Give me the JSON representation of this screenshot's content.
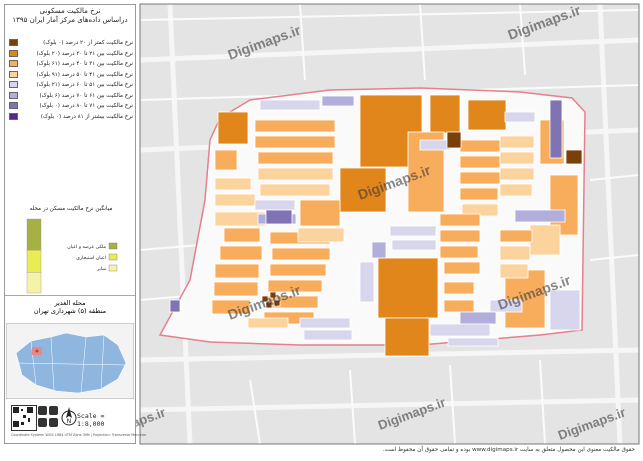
{
  "legend": {
    "title_line1": "نرخ مالکیت مسکونی",
    "title_line2": "دراساس داده‌های مرکز آمار ایران ۱۳۹۵",
    "items": [
      {
        "label": "نرخ مالکیت کمتر از ۲۰ درصد (۰ بلوک)",
        "color": "#7b3f0a"
      },
      {
        "label": "نرخ مالکیت بین ۲۱ تا ۳۰ درصد (۲۰ بلوک)",
        "color": "#e0861a"
      },
      {
        "label": "نرخ مالکیت بین ۳۱ تا ۴۰ درصد (۶۱ بلوک)",
        "color": "#f7ad5c"
      },
      {
        "label": "نرخ مالکیت بین ۴۱ تا ۵۰ درصد (۹۱ بلوک)",
        "color": "#fcd29d"
      },
      {
        "label": "نرخ مالکیت بین ۵۱ تا ۶۰ درصد (۲۱ بلوک)",
        "color": "#d7d6ec"
      },
      {
        "label": "نرخ مالکیت بین ۶۱ تا ۷۰ درصد (۶ بلوک)",
        "color": "#b2aedb"
      },
      {
        "label": "نرخ مالکیت بین ۷۱ تا ۸۰ درصد (۰ بلوک)",
        "color": "#7f73b4"
      },
      {
        "label": "نرخ مالکیت بیشتر از ۸۱ درصد (۰ بلوک)",
        "color": "#54278f"
      }
    ]
  },
  "chart": {
    "title": "میانگین نرخ مالکیت مسکن در محله",
    "items": [
      {
        "label": "ملکی عرصه و اعیان",
        "color": "#a6b043",
        "share": 0.42
      },
      {
        "label": "اعیان استیجاری",
        "color": "#e9ec52",
        "share": 0.3
      },
      {
        "label": "سایر",
        "color": "#f6f3a6",
        "share": 0.28
      }
    ]
  },
  "locator": {
    "title": "محله الغدیر",
    "subtitle": "منطقه (۵) شهرداری تهران"
  },
  "scale": {
    "label": "Scale = 1:8,000"
  },
  "north": {
    "letter": "N"
  },
  "watermark": {
    "text": "Digimaps.ir"
  },
  "credit": {
    "text": "Coordinate System: WGS 1984 UTM Zone 39N | Projection: Transverse Mercator"
  },
  "footer": {
    "text": "حقوق مالکیت معنوی این محصول متعلق به سایت www.digimaps.ir بوده و تمامی حقوق آن محفوظ است."
  },
  "colors": {
    "boundary": "#e5808d",
    "map_bg": "#e4e4e4",
    "road": "#f6f6f6",
    "locator_water": "#8fb6df"
  }
}
